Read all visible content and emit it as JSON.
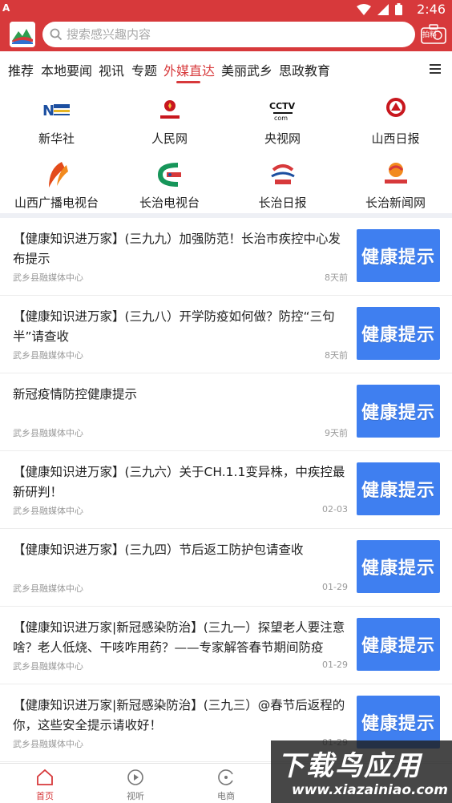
{
  "status_bar": {
    "left_glyph": "A",
    "time": "2:46"
  },
  "header": {
    "search_placeholder": "搜索感兴趣内容",
    "camera_label": "拍料"
  },
  "tabs": [
    {
      "label": "推荐",
      "active": false
    },
    {
      "label": "本地要闻",
      "active": false
    },
    {
      "label": "视讯",
      "active": false
    },
    {
      "label": "专题",
      "active": false
    },
    {
      "label": "外媒直达",
      "active": true
    },
    {
      "label": "美丽武乡",
      "active": false
    },
    {
      "label": "思政教育",
      "active": false
    }
  ],
  "media": [
    {
      "name": "新华社",
      "icon": "xinhua-logo-icon"
    },
    {
      "name": "人民网",
      "icon": "people-logo-icon"
    },
    {
      "name": "央视网",
      "icon": "cctv-logo-icon"
    },
    {
      "name": "山西日报",
      "icon": "shanxi-daily-logo-icon"
    },
    {
      "name": "山西广播电视台",
      "icon": "shanxi-tv-logo-icon"
    },
    {
      "name": "长治电视台",
      "icon": "changzhi-tv-logo-icon"
    },
    {
      "name": "长治日报",
      "icon": "changzhi-daily-logo-icon"
    },
    {
      "name": "长治新闻网",
      "icon": "changzhi-news-logo-icon"
    }
  ],
  "news": [
    {
      "title": "【健康知识进万家】(三九九）加强防范！长治市疾控中心发布提示",
      "source": "武乡县融媒体中心",
      "date": "8天前",
      "thumb_text": "健康提示"
    },
    {
      "title": "【健康知识进万家】(三九八）开学防疫如何做？防控“三句半”请查收",
      "source": "武乡县融媒体中心",
      "date": "8天前",
      "thumb_text": "健康提示"
    },
    {
      "title": "新冠疫情防控健康提示",
      "source": "武乡县融媒体中心",
      "date": "9天前",
      "thumb_text": "健康提示"
    },
    {
      "title": "【健康知识进万家】(三九六）关于CH.1.1变异株，中疾控最新研判！",
      "source": "武乡县融媒体中心",
      "date": "02-03",
      "thumb_text": "健康提示"
    },
    {
      "title": "【健康知识进万家】(三九四）节后返工防护包请查收",
      "source": "武乡县融媒体中心",
      "date": "01-29",
      "thumb_text": "健康提示"
    },
    {
      "title": "【健康知识进万家|新冠感染防治】(三九一）探望老人要注意啥？老人低烧、干咳咋用药？——专家解答春节期间防疫热…",
      "source": "武乡县融媒体中心",
      "date": "01-29",
      "thumb_text": "健康提示"
    },
    {
      "title": "【健康知识进万家|新冠感染防治】(三九三）@春节后返程的你，这些安全提示请收好！",
      "source": "武乡县融媒体中心",
      "date": "01-29",
      "thumb_text": "健康提示"
    }
  ],
  "bottom_nav": [
    {
      "label": "首页",
      "icon": "home-icon",
      "active": true
    },
    {
      "label": "视听",
      "icon": "video-icon",
      "active": false
    },
    {
      "label": "电商",
      "icon": "shop-icon",
      "active": false
    }
  ],
  "watermark": {
    "big": "下载鸟应用",
    "small": "www.xiazainiao.com"
  },
  "colors": {
    "brand_red": "#d7393b",
    "thumb_blue": "#3f7ff0"
  }
}
